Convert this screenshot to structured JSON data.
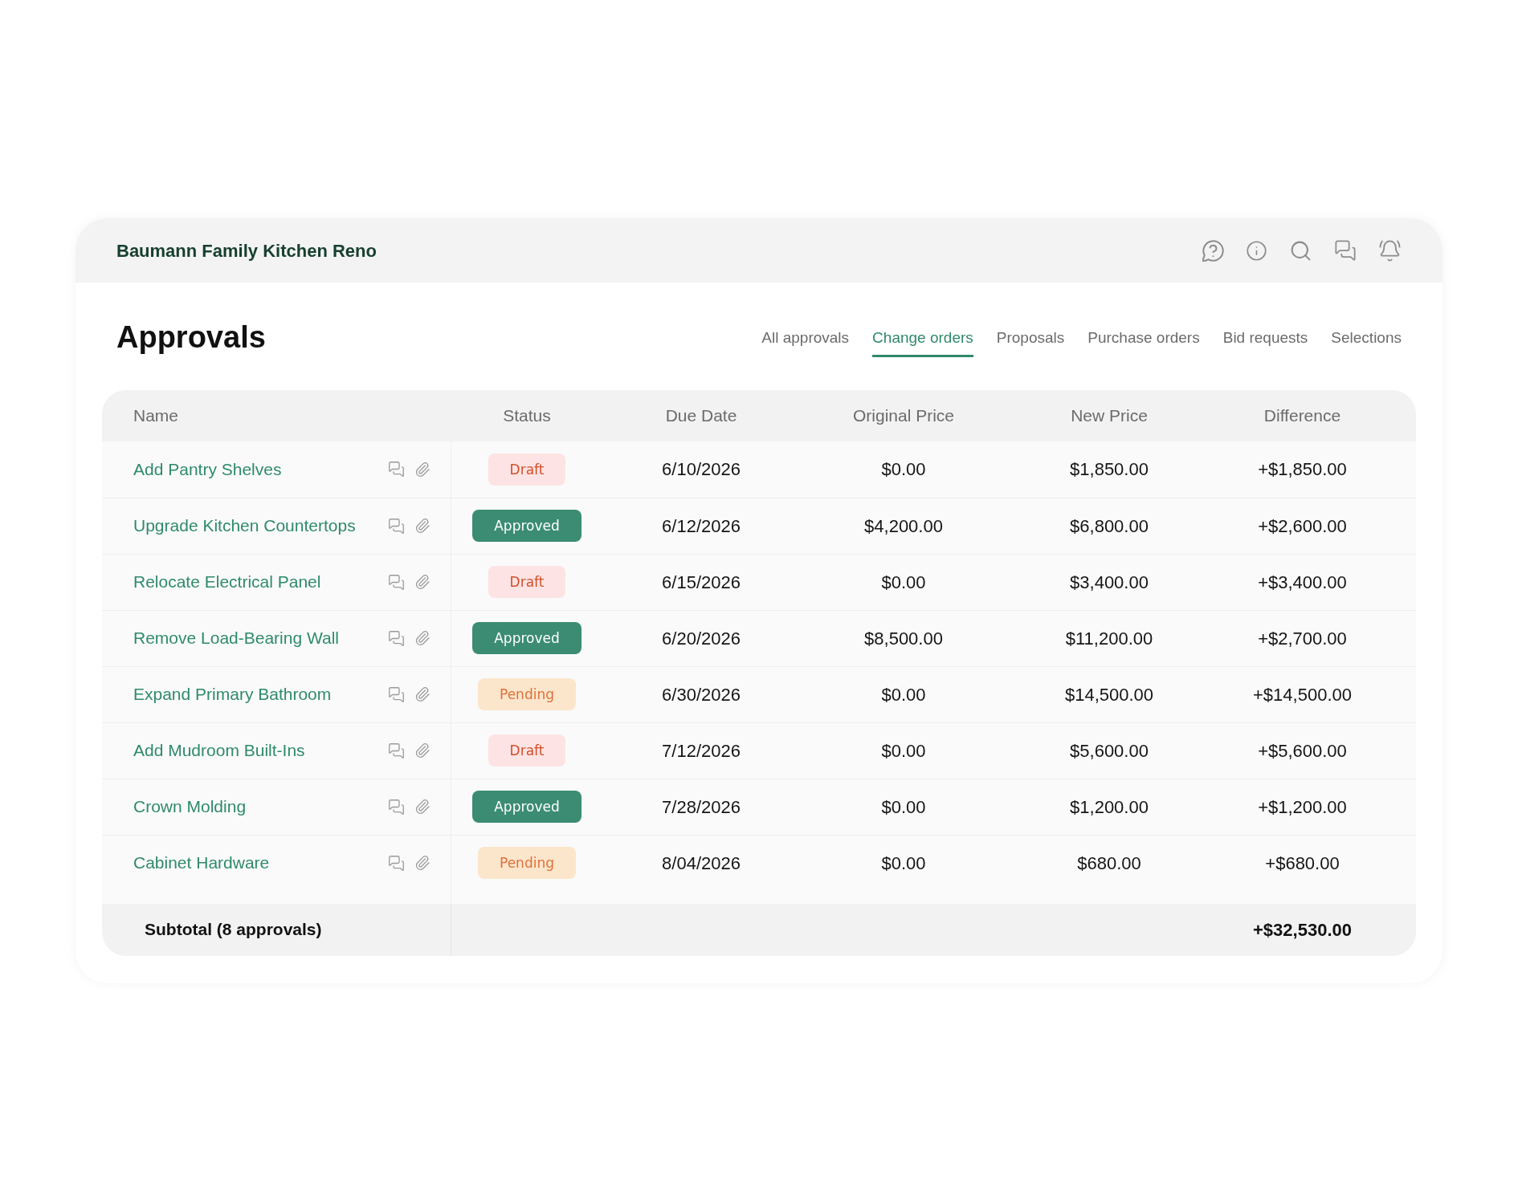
{
  "top_bar": {
    "project_title": "Baumann Family Kitchen Reno"
  },
  "page": {
    "title": "Approvals",
    "tabs": [
      {
        "label": "All approvals",
        "selected": false
      },
      {
        "label": "Change orders",
        "selected": true
      },
      {
        "label": "Proposals",
        "selected": false
      },
      {
        "label": "Purchase orders",
        "selected": false
      },
      {
        "label": "Bid requests",
        "selected": false
      },
      {
        "label": "Selections",
        "selected": false
      }
    ]
  },
  "table": {
    "columns": [
      "Name",
      "Status",
      "Due Date",
      "Original Price",
      "New Price",
      "Difference"
    ],
    "rows": [
      {
        "name": "Add Pantry Shelves",
        "status": {
          "label": "Draft",
          "kind": "draft"
        },
        "due_date": "6/10/2026",
        "original_price": "$0.00",
        "new_price": "$1,850.00",
        "difference": "+$1,850.00"
      },
      {
        "name": "Upgrade Kitchen Countertops",
        "status": {
          "label": "Approved",
          "kind": "approved"
        },
        "due_date": "6/12/2026",
        "original_price": "$4,200.00",
        "new_price": "$6,800.00",
        "difference": "+$2,600.00"
      },
      {
        "name": "Relocate Electrical Panel",
        "status": {
          "label": "Draft",
          "kind": "draft"
        },
        "due_date": "6/15/2026",
        "original_price": "$0.00",
        "new_price": "$3,400.00",
        "difference": "+$3,400.00"
      },
      {
        "name": "Remove Load-Bearing Wall",
        "status": {
          "label": "Approved",
          "kind": "approved"
        },
        "due_date": "6/20/2026",
        "original_price": "$8,500.00",
        "new_price": "$11,200.00",
        "difference": "+$2,700.00"
      },
      {
        "name": "Expand Primary Bathroom",
        "status": {
          "label": "Pending",
          "kind": "pending"
        },
        "due_date": "6/30/2026",
        "original_price": "$0.00",
        "new_price": "$14,500.00",
        "difference": "+$14,500.00"
      },
      {
        "name": "Add Mudroom Built-Ins",
        "status": {
          "label": "Draft",
          "kind": "draft"
        },
        "due_date": "7/12/2026",
        "original_price": "$0.00",
        "new_price": "$5,600.00",
        "difference": "+$5,600.00"
      },
      {
        "name": "Crown Molding",
        "status": {
          "label": "Approved",
          "kind": "approved"
        },
        "due_date": "7/28/2026",
        "original_price": "$0.00",
        "new_price": "$1,200.00",
        "difference": "+$1,200.00"
      },
      {
        "name": "Cabinet Hardware",
        "status": {
          "label": "Pending",
          "kind": "pending"
        },
        "due_date": "8/04/2026",
        "original_price": "$0.00",
        "new_price": "$680.00",
        "difference": "+$680.00"
      }
    ],
    "subtotal": {
      "label": "Subtotal (8 approvals)",
      "difference": "+$32,530.00"
    }
  }
}
